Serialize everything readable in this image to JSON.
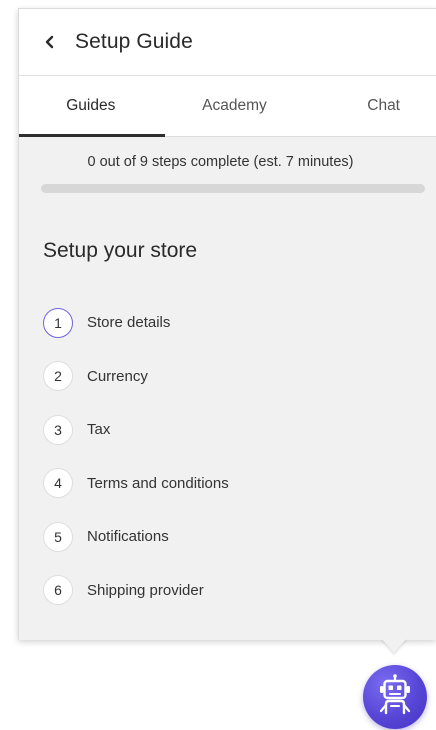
{
  "header": {
    "title": "Setup Guide",
    "back_icon": "chevron-left-icon"
  },
  "tabs": [
    {
      "label": "Guides",
      "active": true
    },
    {
      "label": "Academy",
      "active": false
    },
    {
      "label": "Chat",
      "active": false
    }
  ],
  "progress": {
    "text": "0 out of 9 steps complete (est. 7 minutes)",
    "completed": 0,
    "total": 9
  },
  "section": {
    "title": "Setup your store"
  },
  "steps": [
    {
      "number": "1",
      "label": "Store details",
      "current": true
    },
    {
      "number": "2",
      "label": "Currency",
      "current": false
    },
    {
      "number": "3",
      "label": "Tax",
      "current": false
    },
    {
      "number": "4",
      "label": "Terms and conditions",
      "current": false
    },
    {
      "number": "5",
      "label": "Notifications",
      "current": false
    },
    {
      "number": "6",
      "label": "Shipping provider",
      "current": false
    }
  ],
  "assistant_button": {
    "icon": "robot-icon"
  },
  "colors": {
    "accent": "#6f63e0",
    "panel_background": "#f1f1f1",
    "bot_button": "#5746d6"
  }
}
